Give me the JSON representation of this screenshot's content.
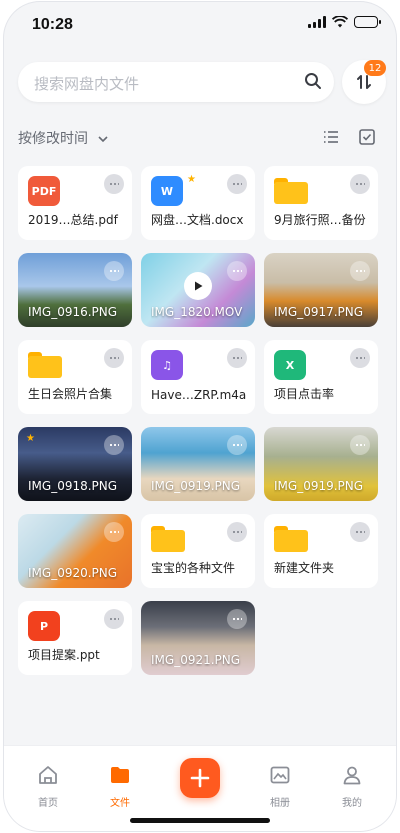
{
  "status_bar": {
    "time": "10:28"
  },
  "search": {
    "placeholder": "搜索网盘内文件"
  },
  "sort_badge": "12",
  "sort": {
    "label": "按修改时间"
  },
  "files": [
    {
      "name": "2019…总结.pdf",
      "kind": "pdf",
      "icon_text": "PDF",
      "color": "#f05a3a"
    },
    {
      "name": "网盘…文档.docx",
      "kind": "word",
      "icon_text": "W",
      "color": "#2f8cff",
      "starred": true
    },
    {
      "name": "9月旅行照…备份",
      "kind": "folder"
    },
    {
      "name": "IMG_0916.PNG",
      "kind": "photo",
      "scene": "tower"
    },
    {
      "name": "IMG_1820.MOV",
      "kind": "video",
      "scene": "desk"
    },
    {
      "name": "IMG_0917.PNG",
      "kind": "photo",
      "scene": "bread"
    },
    {
      "name": "生日会照片合集",
      "kind": "folder"
    },
    {
      "name": "Have…ZRP.m4a",
      "kind": "audio",
      "icon_text": "♫",
      "color": "#8a55e8"
    },
    {
      "name": "项目点击率",
      "kind": "excel",
      "icon_text": "X",
      "color": "#1fb87a"
    },
    {
      "name": "IMG_0918.PNG",
      "kind": "photo",
      "scene": "night",
      "starred": true
    },
    {
      "name": "IMG_0919.PNG",
      "kind": "photo",
      "scene": "beach"
    },
    {
      "name": "IMG_0919.PNG",
      "kind": "photo",
      "scene": "figures"
    },
    {
      "name": "IMG_0920.PNG",
      "kind": "photo",
      "scene": "orange"
    },
    {
      "name": "宝宝的各种文件",
      "kind": "folder"
    },
    {
      "name": "新建文件夹",
      "kind": "folder"
    },
    {
      "name": "项目提案.ppt",
      "kind": "ppt",
      "icon_text": "P",
      "color": "#f2411e"
    },
    {
      "name": "IMG_0921.PNG",
      "kind": "photo",
      "scene": "drinks"
    }
  ],
  "tabs": [
    {
      "label": "首页",
      "icon": "home-icon"
    },
    {
      "label": "文件",
      "icon": "folder-icon",
      "active": true
    },
    {
      "label": "相册",
      "icon": "image-icon"
    },
    {
      "label": "我的",
      "icon": "user-icon"
    }
  ]
}
